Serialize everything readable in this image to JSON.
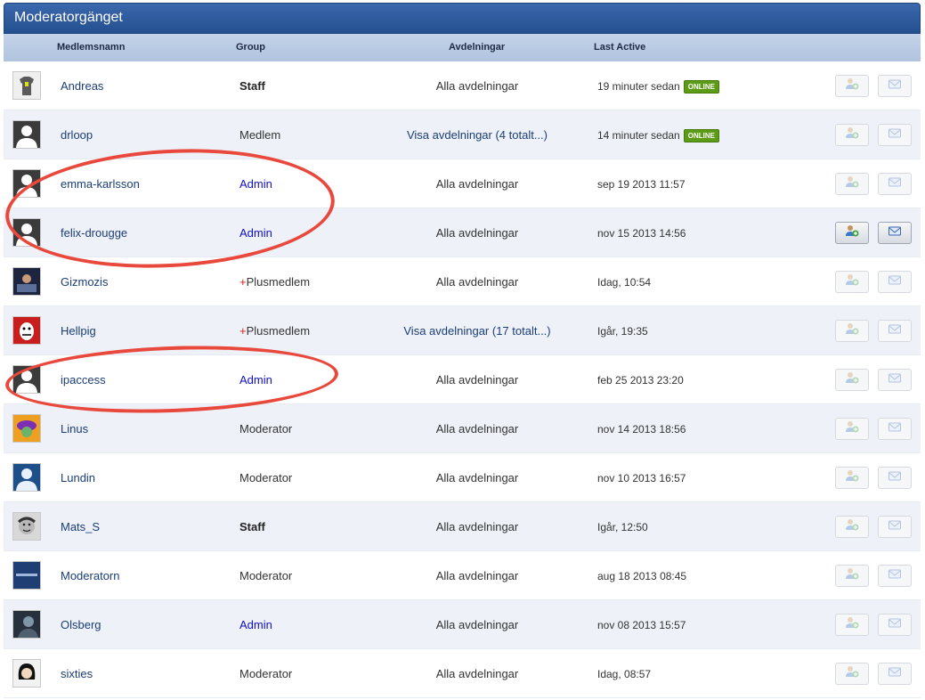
{
  "panel": {
    "title": "Moderatorgänget"
  },
  "columns": {
    "name": "Medlemsnamn",
    "group": "Group",
    "departments": "Avdelningar",
    "last_active": "Last Active"
  },
  "online_badge": "ONLINE",
  "colors": {
    "title_bar": "#2d5b9e",
    "header_row": "#b8c9e2",
    "link": "#1b3d77",
    "admin": "#1010c8",
    "plus": "#d81e1e",
    "online": "#5b9b16",
    "annotation_ring": "#e8493c"
  },
  "rows": [
    {
      "name": "Andreas",
      "plus": "",
      "group": "Staff",
      "departments": "Alla avdelningar",
      "last_active": "19 minuter sedan",
      "online": true,
      "avatar": "tshirt-avatar",
      "actions_enabled": false
    },
    {
      "name": "drloop",
      "plus": "",
      "group": "Medlem",
      "departments": "Visa avdelningar (4 totalt...)",
      "last_active": "14 minuter sedan",
      "online": true,
      "avatar": "default-avatar",
      "actions_enabled": false
    },
    {
      "name": "emma-karlsson",
      "plus": "",
      "group": "Admin",
      "departments": "Alla avdelningar",
      "last_active": "sep 19 2013 11:57",
      "online": false,
      "avatar": "default-avatar",
      "actions_enabled": false
    },
    {
      "name": "felix-drougge",
      "plus": "",
      "group": "Admin",
      "departments": "Alla avdelningar",
      "last_active": "nov 15 2013 14:56",
      "online": false,
      "avatar": "default-avatar",
      "actions_enabled": true
    },
    {
      "name": "Gizmozis",
      "plus": "+",
      "group": "Plusmedlem",
      "departments": "Alla avdelningar",
      "last_active": "Idag, 10:54",
      "online": false,
      "avatar": "photo-avatar",
      "actions_enabled": false
    },
    {
      "name": "Hellpig",
      "plus": "+",
      "group": "Plusmedlem",
      "departments": "Visa avdelningar (17 totalt...)",
      "last_active": "Igår, 19:35",
      "online": false,
      "avatar": "red-character-avatar",
      "actions_enabled": false
    },
    {
      "name": "ipaccess",
      "plus": "",
      "group": "Admin",
      "departments": "Alla avdelningar",
      "last_active": "feb 25 2013 23:20",
      "online": false,
      "avatar": "default-avatar",
      "actions_enabled": false
    },
    {
      "name": "Linus",
      "plus": "",
      "group": "Moderator",
      "departments": "Alla avdelningar",
      "last_active": "nov 14 2013 18:56",
      "online": false,
      "avatar": "purple-hat-avatar",
      "actions_enabled": false
    },
    {
      "name": "Lundin",
      "plus": "",
      "group": "Moderator",
      "departments": "Alla avdelningar",
      "last_active": "nov 10 2013 16:57",
      "online": false,
      "avatar": "blue-default-avatar",
      "actions_enabled": false
    },
    {
      "name": "Mats_S",
      "plus": "",
      "group": "Staff",
      "departments": "Alla avdelningar",
      "last_active": "Igår, 12:50",
      "online": false,
      "avatar": "face-avatar",
      "actions_enabled": false
    },
    {
      "name": "Moderatorn",
      "plus": "",
      "group": "Moderator",
      "departments": "Alla avdelningar",
      "last_active": "aug 18 2013 08:45",
      "online": false,
      "avatar": "logo-avatar",
      "actions_enabled": false
    },
    {
      "name": "Olsberg",
      "plus": "",
      "group": "Admin",
      "departments": "Alla avdelningar",
      "last_active": "nov 08 2013 15:57",
      "online": false,
      "avatar": "dark-photo-avatar",
      "actions_enabled": false
    },
    {
      "name": "sixties",
      "plus": "",
      "group": "Moderator",
      "departments": "Alla avdelningar",
      "last_active": "Idag, 08:57",
      "online": false,
      "avatar": "hair-avatar",
      "actions_enabled": false
    }
  ]
}
